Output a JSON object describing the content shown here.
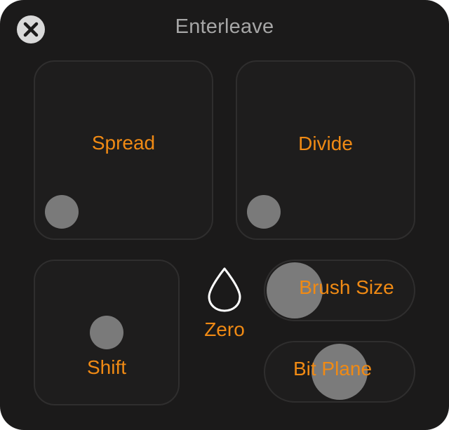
{
  "window": {
    "title": "Enterleave",
    "close_icon": "close-icon",
    "background_color": "#1b1a1a"
  },
  "accent_color": "#f08a14",
  "pads": {
    "spread": {
      "label": "Spread"
    },
    "divide": {
      "label": "Divide"
    },
    "shift": {
      "label": "Shift"
    }
  },
  "zero": {
    "label": "Zero",
    "icon": "drop-icon"
  },
  "sliders": {
    "brush_size": {
      "label": "Brush Size"
    },
    "bit_plane": {
      "label": "Bit Plane"
    }
  }
}
